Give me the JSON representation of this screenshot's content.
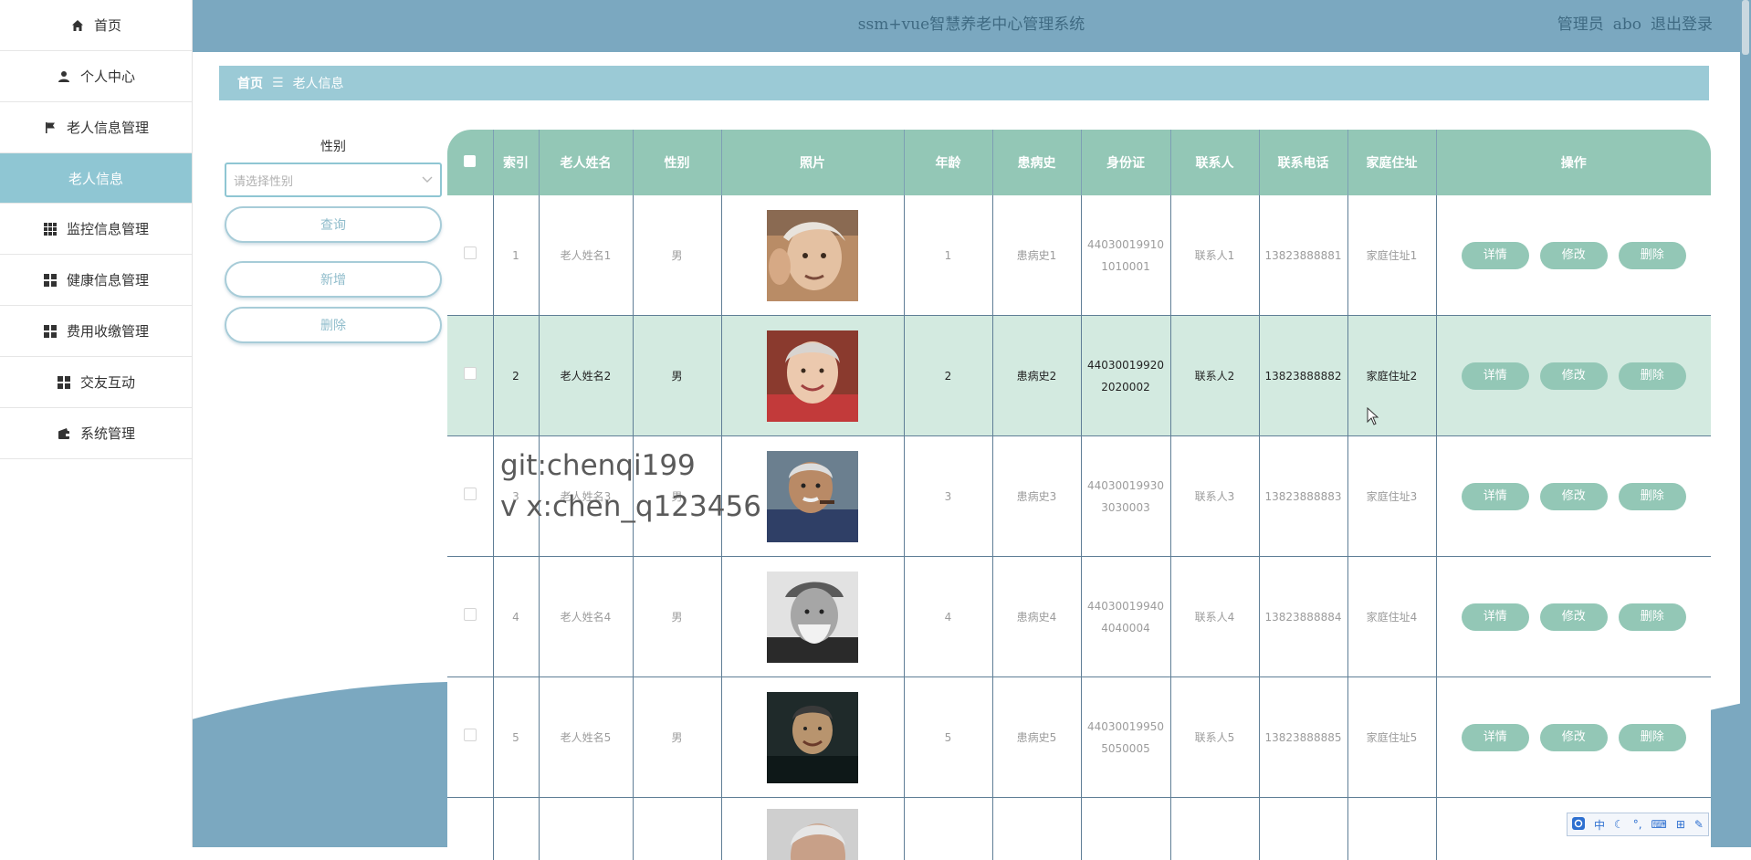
{
  "app": {
    "title": "ssm+vue智慧养老中心管理系统",
    "user_role": "管理员",
    "username": "abo",
    "logout": "退出登录"
  },
  "sidebar": {
    "items": [
      {
        "label": "首页",
        "icon": "home-icon"
      },
      {
        "label": "个人中心",
        "icon": "user-icon"
      },
      {
        "label": "老人信息管理",
        "icon": "flag-icon"
      },
      {
        "label": "老人信息",
        "icon": ""
      },
      {
        "label": "监控信息管理",
        "icon": "grid-icon"
      },
      {
        "label": "健康信息管理",
        "icon": "grid4-icon"
      },
      {
        "label": "费用收缴管理",
        "icon": "grid4-icon"
      },
      {
        "label": "交友互动",
        "icon": "grid4-icon"
      },
      {
        "label": "系统管理",
        "icon": "wallet-icon"
      }
    ]
  },
  "breadcrumb": {
    "home": "首页",
    "separator": "☰",
    "current": "老人信息"
  },
  "search": {
    "gender_label": "性别",
    "gender_placeholder": "请选择性别",
    "query_button": "查询",
    "add_button": "新增",
    "delete_button": "删除"
  },
  "table": {
    "columns": [
      "索引",
      "老人姓名",
      "性别",
      "照片",
      "年龄",
      "患病史",
      "身份证",
      "联系人",
      "联系电话",
      "家庭住址",
      "操作"
    ],
    "actions": {
      "detail": "详情",
      "edit": "修改",
      "delete": "删除"
    },
    "rows": [
      {
        "index": "1",
        "name": "老人姓名1",
        "gender": "男",
        "age": "1",
        "history": "患病史1",
        "id_card": "440300199101010001",
        "contact": "联系人1",
        "phone": "13823888881",
        "address": "家庭住址1"
      },
      {
        "index": "2",
        "name": "老人姓名2",
        "gender": "男",
        "age": "2",
        "history": "患病史2",
        "id_card": "440300199202020002",
        "contact": "联系人2",
        "phone": "13823888882",
        "address": "家庭住址2"
      },
      {
        "index": "3",
        "name": "老人姓名3",
        "gender": "男",
        "age": "3",
        "history": "患病史3",
        "id_card": "440300199303030003",
        "contact": "联系人3",
        "phone": "13823888883",
        "address": "家庭住址3"
      },
      {
        "index": "4",
        "name": "老人姓名4",
        "gender": "男",
        "age": "4",
        "history": "患病史4",
        "id_card": "440300199404040004",
        "contact": "联系人4",
        "phone": "13823888884",
        "address": "家庭住址4"
      },
      {
        "index": "5",
        "name": "老人姓名5",
        "gender": "男",
        "age": "5",
        "history": "患病史5",
        "id_card": "440300199505050005",
        "contact": "联系人5",
        "phone": "13823888885",
        "address": "家庭住址5"
      }
    ]
  },
  "watermark": {
    "line1": "git:chenqi199",
    "line2": "v x:chen_q123456"
  },
  "ime_toolbar": {
    "lang": "中"
  },
  "colors": {
    "header": "#7ba8c0",
    "accent": "#93c7b6",
    "breadcrumb": "#9bcad6",
    "highlight_row": "#d3eae0"
  }
}
